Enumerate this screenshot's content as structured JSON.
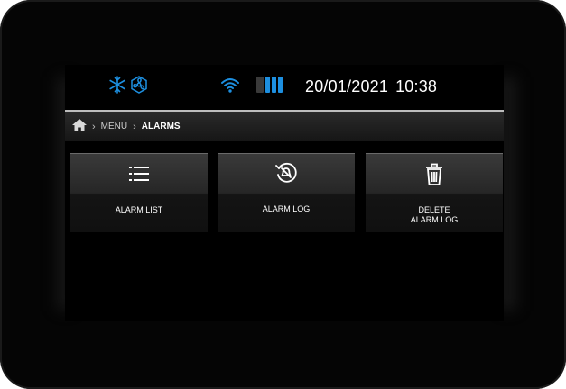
{
  "status": {
    "date": "20/01/2021",
    "time": "10:38",
    "icons": [
      "snowflake-icon",
      "fan-icon",
      "wifi-icon",
      "battery-icon"
    ],
    "accent_color": "#1d8fe0"
  },
  "breadcrumb": {
    "home_icon": "home-icon",
    "items": [
      "MENU",
      "ALARMS"
    ]
  },
  "tiles": [
    {
      "label": "ALARM LIST",
      "icon": "list-icon"
    },
    {
      "label": "ALARM LOG",
      "icon": "alarm-log-icon"
    },
    {
      "label_line1": "DELETE",
      "label_line2": "ALARM LOG",
      "icon": "trash-icon"
    }
  ]
}
